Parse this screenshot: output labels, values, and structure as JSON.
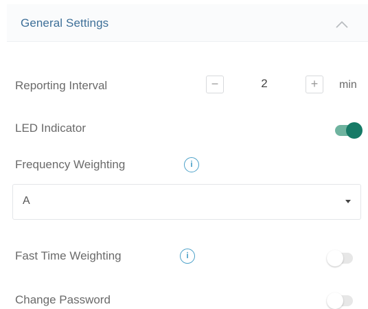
{
  "section": {
    "title": "General Settings"
  },
  "reporting_interval": {
    "label": "Reporting Interval",
    "decrement_label": "−",
    "increment_label": "+",
    "value": "2",
    "unit": "min"
  },
  "led_indicator": {
    "label": "LED Indicator",
    "enabled": true
  },
  "frequency_weighting": {
    "label": "Frequency Weighting",
    "info_glyph": "i",
    "selected": "A"
  },
  "fast_time_weighting": {
    "label": "Fast Time Weighting",
    "info_glyph": "i",
    "enabled": false
  },
  "change_password": {
    "label": "Change Password",
    "enabled": false
  },
  "colors": {
    "accent": "#167a66",
    "title": "#3d6f98",
    "info": "#4aa0c8"
  },
  "icons": [
    "chevron-up-icon",
    "info-icon",
    "dropdown-caret-icon"
  ]
}
